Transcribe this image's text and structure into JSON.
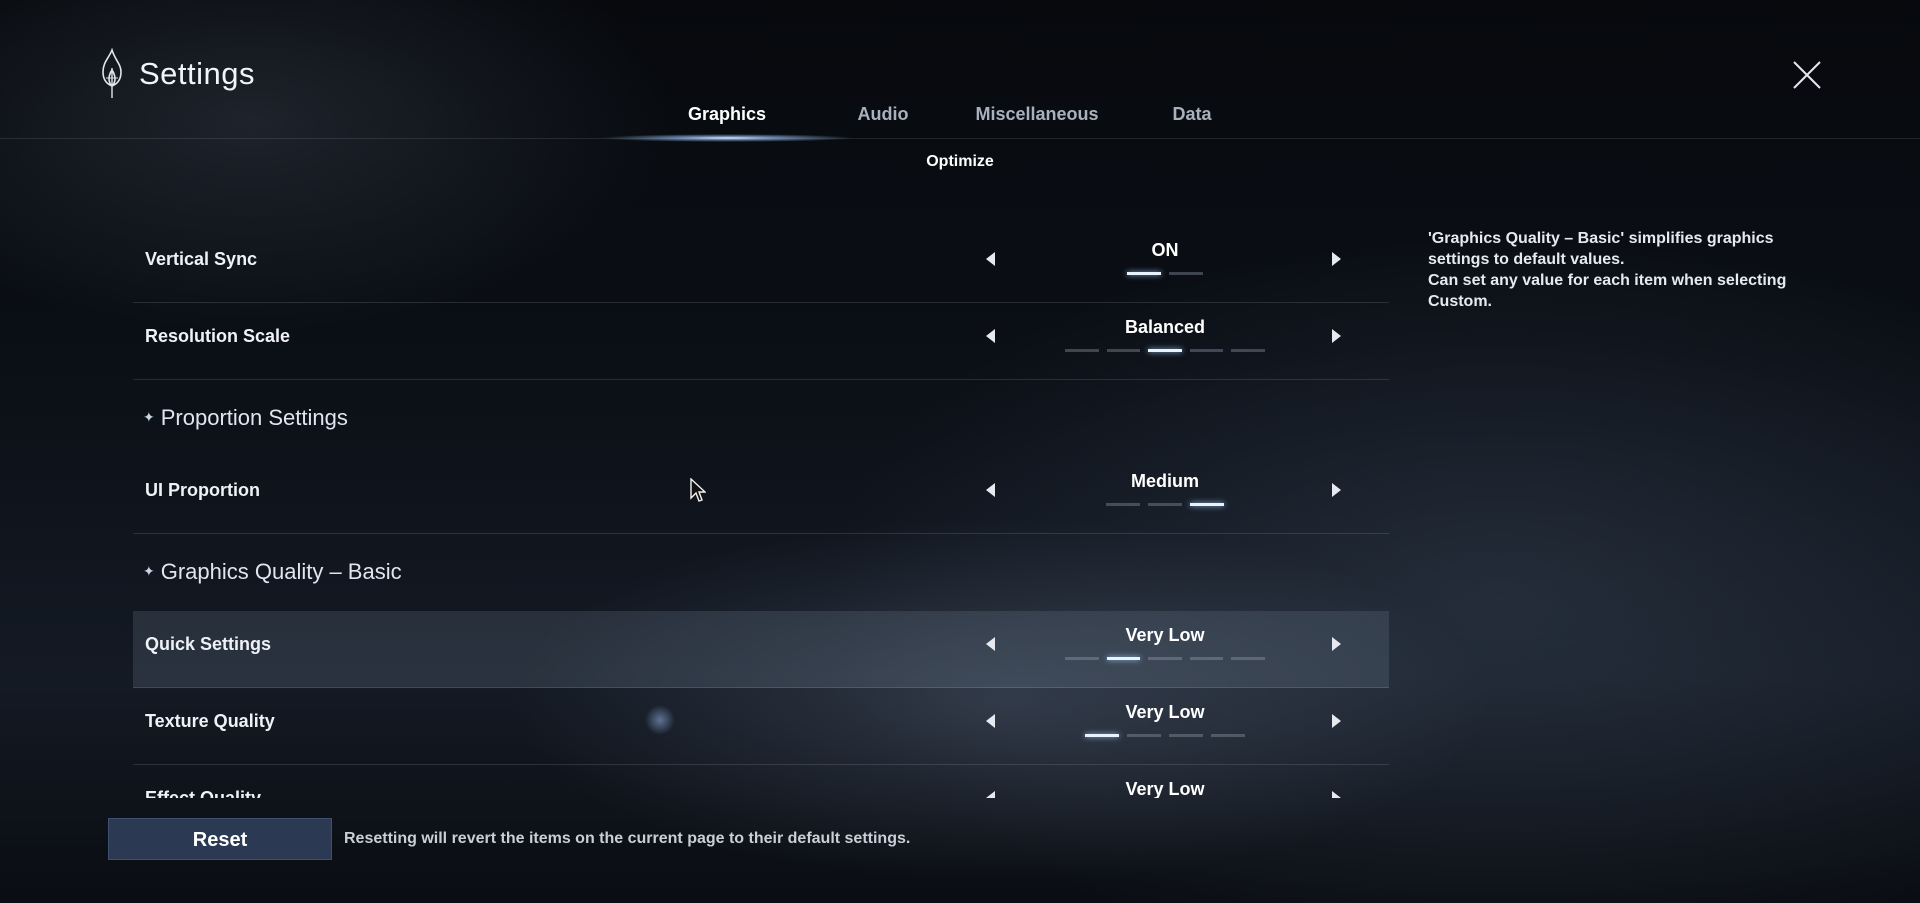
{
  "header": {
    "title": "Settings"
  },
  "tabs": [
    {
      "label": "Graphics",
      "active": true
    },
    {
      "label": "Audio",
      "active": false
    },
    {
      "label": "Miscellaneous",
      "active": false
    },
    {
      "label": "Data",
      "active": false
    }
  ],
  "subtab": {
    "label": "Optimize"
  },
  "settings": {
    "vertical_sync": {
      "label": "Vertical Sync",
      "value": "ON",
      "levels": 2,
      "selected": 1
    },
    "resolution_scale": {
      "label": "Resolution Scale",
      "value": "Balanced",
      "levels": 5,
      "selected": 3
    },
    "proportion_section": {
      "label": "Proportion Settings"
    },
    "ui_proportion": {
      "label": "UI Proportion",
      "value": "Medium",
      "levels": 3,
      "selected": 3
    },
    "graphics_basic_section": {
      "label": "Graphics Quality – Basic"
    },
    "quick_settings": {
      "label": "Quick Settings",
      "value": "Very Low",
      "levels": 5,
      "selected": 2
    },
    "texture_quality": {
      "label": "Texture Quality",
      "value": "Very Low",
      "levels": 4,
      "selected": 1
    },
    "effect_quality": {
      "label": "Effect Quality",
      "value": "Very Low"
    }
  },
  "info": {
    "line1": "'Graphics Quality – Basic' simplifies graphics settings to default values.",
    "line2": "Can set any value for each item when selecting Custom."
  },
  "footer": {
    "reset_label": "Reset",
    "note": "Resetting will revert the items on the current page to their default settings."
  },
  "icons": {
    "logo": "flame-logo-icon",
    "close": "close-icon",
    "prev": "chevron-left-icon",
    "next": "chevron-right-icon",
    "cursor": "mouse-cursor-icon"
  },
  "colors": {
    "accent": "#e9f2ff",
    "reset_bg": "#2b3a52"
  }
}
